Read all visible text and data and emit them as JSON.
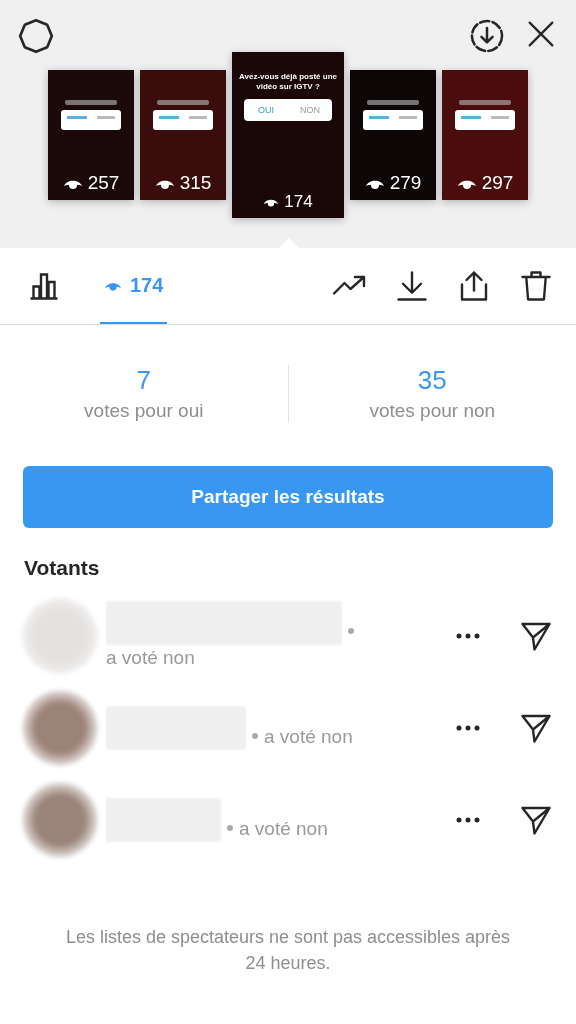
{
  "thumbnails": [
    {
      "views": "257",
      "selected": false
    },
    {
      "views": "315",
      "selected": false
    },
    {
      "views": "174",
      "selected": true,
      "question": "Avez-vous déjà posté une vidéo sur IGTV ?",
      "options": [
        "OUI",
        "NON"
      ]
    },
    {
      "views": "279",
      "selected": false
    },
    {
      "views": "297",
      "selected": false
    }
  ],
  "tabs": [
    {
      "kind": "chart",
      "selected": false
    },
    {
      "kind": "viewers",
      "label": "174",
      "selected": true
    }
  ],
  "results": [
    {
      "count": "7",
      "label": "votes pour oui"
    },
    {
      "count": "35",
      "label": "votes pour non"
    }
  ],
  "share_button": "Partager les résultats",
  "voters": {
    "title": "Votants",
    "items": [
      {
        "vote": "a voté non",
        "color": "#e4e2e1"
      },
      {
        "vote": "a voté non",
        "color": "#9c8378"
      },
      {
        "vote": "a voté non",
        "color": "#9a8479"
      }
    ]
  },
  "footer": "Les listes de spectateurs ne sont pas accessibles après 24 heures."
}
